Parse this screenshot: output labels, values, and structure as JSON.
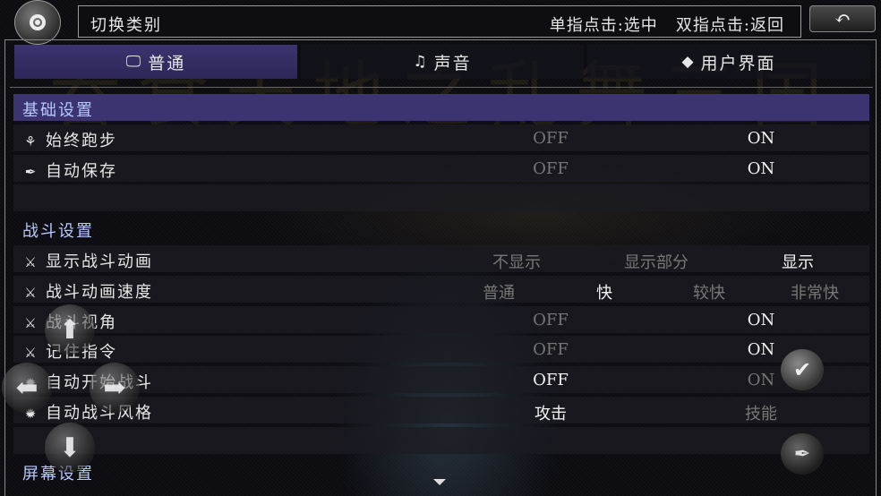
{
  "header": {
    "title": "切换类别",
    "hint": "单指点击:选中   双指点击:返回"
  },
  "watermark": "吞食天地之乱舞三国",
  "tabs": [
    {
      "label": "普通",
      "icon": "monitor-icon",
      "active": true
    },
    {
      "label": "声音",
      "icon": "lyre-icon",
      "active": false
    },
    {
      "label": "用户界面",
      "icon": "tag-icon",
      "active": false
    }
  ],
  "sections": {
    "basic": "基础设置",
    "battle": "战斗设置",
    "screen": "屏幕设置"
  },
  "settings": {
    "always_run": {
      "label": "始终跑步",
      "options": [
        "OFF",
        "ON"
      ],
      "selected": "ON"
    },
    "auto_save": {
      "label": "自动保存",
      "options": [
        "OFF",
        "ON"
      ],
      "selected": "ON"
    },
    "battle_anim": {
      "label": "显示战斗动画",
      "options": [
        "不显示",
        "显示部分",
        "显示"
      ],
      "selected": "显示"
    },
    "anim_speed": {
      "label": "战斗动画速度",
      "options": [
        "普通",
        "快",
        "较快",
        "非常快"
      ],
      "selected": "快"
    },
    "view_angle": {
      "label": "战斗视角",
      "options": [
        "OFF",
        "ON"
      ],
      "selected": "ON"
    },
    "remember_cmd": {
      "label": "记住指令",
      "options": [
        "OFF",
        "ON"
      ],
      "selected": "ON"
    },
    "auto_start": {
      "label": "自动开始战斗",
      "options": [
        "OFF",
        "ON"
      ],
      "selected": "OFF"
    },
    "auto_style": {
      "label": "自动战斗风格",
      "options": [
        "攻击",
        "技能"
      ],
      "selected": "攻击"
    }
  },
  "icons": {
    "menu": "settings-ring-icon",
    "back": "back-arrow-icon",
    "confirm": "check-icon",
    "feather": "feather-icon"
  }
}
